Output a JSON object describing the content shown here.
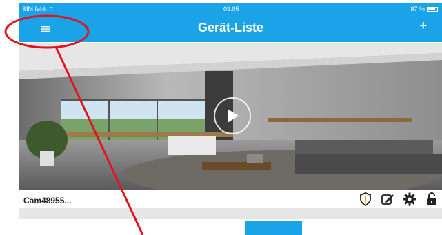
{
  "status_bar": {
    "carrier": "SIM fehlt ⌔",
    "time": "09:05",
    "battery": "87 %"
  },
  "nav": {
    "title": "Gerät-Liste",
    "add_label": "+"
  },
  "device": {
    "name": "Cam48955..."
  },
  "icons": {
    "menu": "hamburger-menu-icon",
    "add": "plus-icon",
    "play": "play-icon",
    "alarm": "shield-alert-icon",
    "edit": "edit-icon",
    "settings": "gear-icon",
    "lock": "unlock-icon"
  },
  "colors": {
    "accent": "#1aa3e6",
    "annotation": "#e0141e"
  }
}
